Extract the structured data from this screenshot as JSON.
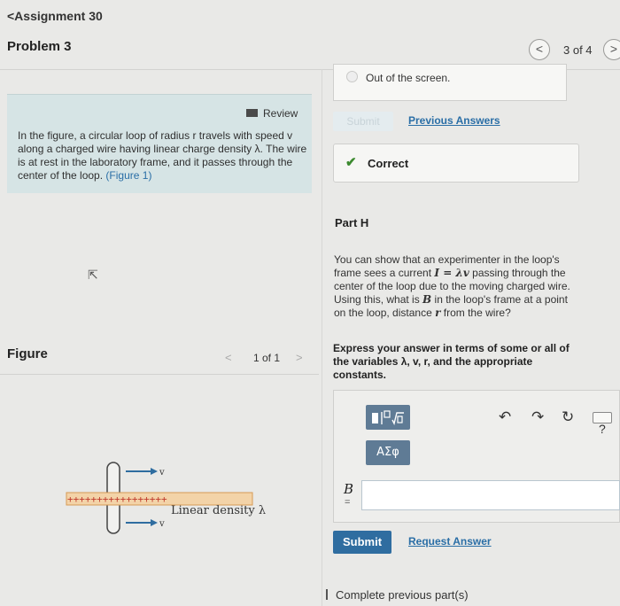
{
  "header": {
    "back_link": "<Assignment 30",
    "problem_title": "Problem 3",
    "nav_prev": "<",
    "nav_count": "3 of 4",
    "nav_next": ">"
  },
  "left": {
    "review_label": "Review",
    "problem_text": "In the figure, a circular loop of radius r travels with speed v along a charged wire having linear charge density λ. The wire is at rest in the laboratory frame, and it passes through the center of the loop.",
    "figure_link": "(Figure 1)",
    "figure_label": "Figure",
    "fig_prev": "<",
    "fig_count": "1 of 1",
    "fig_next": ">",
    "diagram_label": "Linear density λ",
    "diagram_charges": "+++++++++++++++++",
    "velocity_label": "v"
  },
  "right": {
    "prev_option_text": "Out of the screen.",
    "submit_disabled": "Submit",
    "previous_answers": "Previous Answers",
    "correct_text": "Correct",
    "part_title": "Part H",
    "part_text_1": "You can show that an experimenter in the loop's frame sees a current ",
    "part_text_I": "I",
    "part_text_eq": " = λv",
    "part_text_2": " passing through the center of the loop due to the moving charged wire. Using this, what is ",
    "part_text_B": "B",
    "part_text_3": " in the loop's frame at a point on the loop, distance ",
    "part_text_r": "r",
    "part_text_4": " from the wire?",
    "express_text": "Express your answer in terms of some or all of the variables λ, v, r, and the appropriate constants.",
    "tool_greek": "ΑΣφ",
    "help_label": "?",
    "answer_var": "B",
    "answer_eq": "=",
    "answer_value": "",
    "submit_label": "Submit",
    "request_answer": "Request Answer",
    "complete_previous": "Complete previous part(s)"
  },
  "colors": {
    "info_bg": "#d6e4e5",
    "link": "#2a6ea6",
    "submit_bg": "#2f6da0",
    "tool_bg": "#5f7b95",
    "correct_check": "#3c8a2f"
  }
}
